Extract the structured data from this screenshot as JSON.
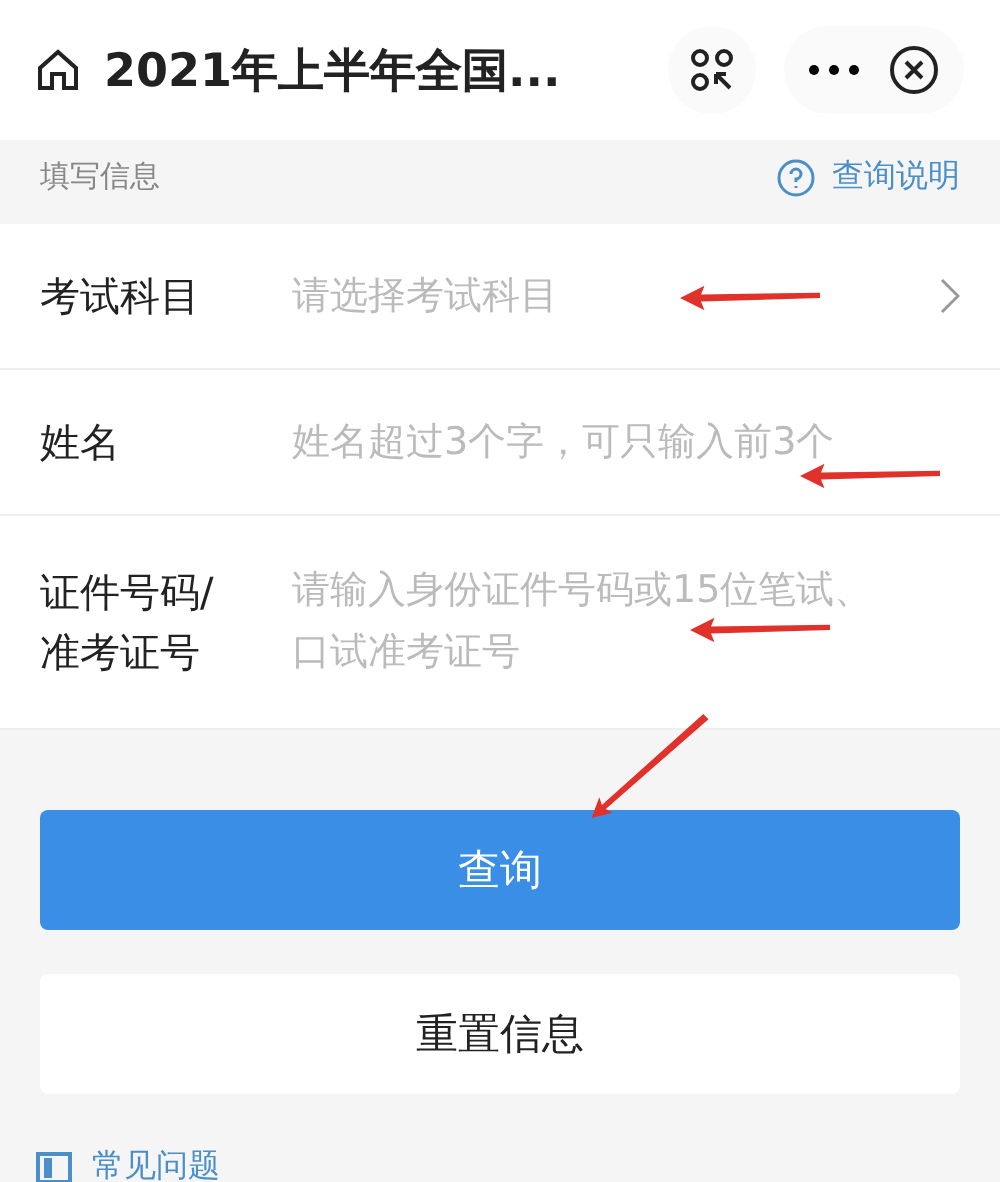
{
  "top_bar": {
    "title": "2021年上半年全国..."
  },
  "section": {
    "label": "填写信息",
    "help_link": "查询说明"
  },
  "fields": [
    {
      "kind": "select",
      "label": "考试科目",
      "placeholder": "请选择考试科目",
      "arrow": true
    },
    {
      "kind": "text",
      "label": "姓名",
      "placeholder": "姓名超过3个字，可只输入前3个",
      "arrow": true
    },
    {
      "kind": "multiline",
      "label": "证件号码/准考证号",
      "placeholder": "请输入身份证件号码或15位笔试、口试准考证号",
      "arrow": true
    }
  ],
  "buttons": [
    {
      "kind": "primary",
      "label": "查询",
      "arrow": true
    },
    {
      "kind": "secondary",
      "label": "重置信息",
      "arrow": false
    }
  ],
  "footer_link": "常见问题"
}
